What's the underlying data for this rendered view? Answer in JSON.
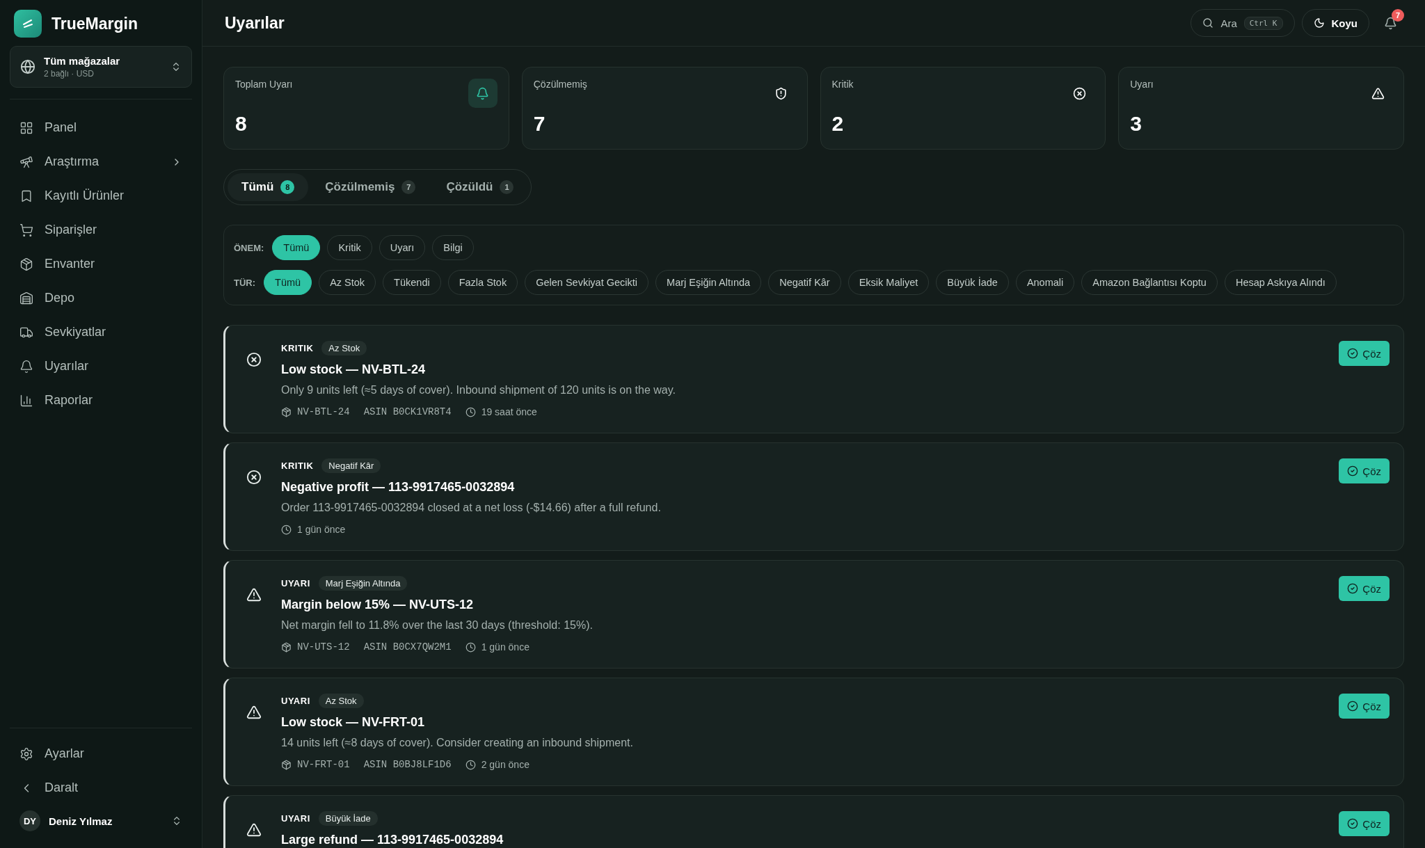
{
  "brand": {
    "name": "TrueMargin"
  },
  "store_picker": {
    "title": "Tüm mağazalar",
    "subtitle": "2 bağlı · USD"
  },
  "nav": [
    {
      "label": "Panel",
      "has_submenu": false
    },
    {
      "label": "Araştırma",
      "has_submenu": true
    },
    {
      "label": "Kayıtlı Ürünler",
      "has_submenu": false
    },
    {
      "label": "Siparişler",
      "has_submenu": false
    },
    {
      "label": "Envanter",
      "has_submenu": false
    },
    {
      "label": "Depo",
      "has_submenu": false
    },
    {
      "label": "Sevkiyatlar",
      "has_submenu": false
    },
    {
      "label": "Uyarılar",
      "has_submenu": false
    },
    {
      "label": "Raporlar",
      "has_submenu": false
    }
  ],
  "sidebar_footer": [
    {
      "label": "Ayarlar"
    },
    {
      "label": "Daralt"
    }
  ],
  "user": {
    "initials": "DY",
    "name": "Deniz Yılmaz"
  },
  "header": {
    "title": "Uyarılar",
    "search": {
      "label": "Ara",
      "shortcut": "Ctrl K"
    },
    "theme": "Koyu",
    "notifications": "7"
  },
  "stats": [
    {
      "label": "Toplam Uyarı",
      "value": "8",
      "highlighted": true
    },
    {
      "label": "Çözülmemiş",
      "value": "7",
      "highlighted": false
    },
    {
      "label": "Kritik",
      "value": "2",
      "highlighted": false
    },
    {
      "label": "Uyarı",
      "value": "3",
      "highlighted": false
    }
  ],
  "tabs": [
    {
      "label": "Tümü",
      "count": "8",
      "selected": true
    },
    {
      "label": "Çözülmemiş",
      "count": "7",
      "selected": false
    },
    {
      "label": "Çözüldü",
      "count": "1",
      "selected": false
    }
  ],
  "filters": [
    {
      "label": "ÖNEM:",
      "options": [
        {
          "label": "Tümü",
          "selected": true
        },
        {
          "label": "Kritik",
          "selected": false
        },
        {
          "label": "Uyarı",
          "selected": false
        },
        {
          "label": "Bilgi",
          "selected": false
        }
      ]
    },
    {
      "label": "TÜR:",
      "options": [
        {
          "label": "Tümü",
          "selected": true
        },
        {
          "label": "Az Stok",
          "selected": false
        },
        {
          "label": "Tükendi",
          "selected": false
        },
        {
          "label": "Fazla Stok",
          "selected": false
        },
        {
          "label": "Gelen Sevkiyat Gecikti",
          "selected": false
        },
        {
          "label": "Marj Eşiğin Altında",
          "selected": false
        },
        {
          "label": "Negatif Kâr",
          "selected": false
        },
        {
          "label": "Eksik Maliyet",
          "selected": false
        },
        {
          "label": "Büyük İade",
          "selected": false
        },
        {
          "label": "Anomali",
          "selected": false
        },
        {
          "label": "Amazon Bağlantısı Koptu",
          "selected": false
        },
        {
          "label": "Hesap Askıya Alındı",
          "selected": false
        }
      ]
    }
  ],
  "alerts": [
    {
      "kind": "critical",
      "severity": "KRITIK",
      "type": "Az Stok",
      "title": "Low stock — NV-BTL-24",
      "message": "Only 9 units left (≈5 days of cover). Inbound shipment of 120 units is on the way.",
      "sku": "NV-BTL-24",
      "asin": "ASIN B0CK1VR8T4",
      "time": "19 saat önce",
      "action": "Çöz"
    },
    {
      "kind": "critical",
      "severity": "KRITIK",
      "type": "Negatif Kâr",
      "title": "Negative profit — 113-9917465-0032894",
      "message": "Order 113-9917465-0032894 closed at a net loss (-$14.66) after a full refund.",
      "time": "1 gün önce",
      "action": "Çöz"
    },
    {
      "kind": "warning",
      "severity": "UYARI",
      "type": "Marj Eşiğin Altında",
      "title": "Margin below 15% — NV-UTS-12",
      "message": "Net margin fell to 11.8% over the last 30 days (threshold: 15%).",
      "sku": "NV-UTS-12",
      "asin": "ASIN B0CX7QW2M1",
      "time": "1 gün önce",
      "action": "Çöz"
    },
    {
      "kind": "warning",
      "severity": "UYARI",
      "type": "Az Stok",
      "title": "Low stock — NV-FRT-01",
      "message": "14 units left (≈8 days of cover). Consider creating an inbound shipment.",
      "sku": "NV-FRT-01",
      "asin": "ASIN B0BJ8LF1D6",
      "time": "2 gün önce",
      "action": "Çöz"
    },
    {
      "kind": "warning",
      "severity": "UYARI",
      "type": "Büyük İade",
      "title": "Large refund — 113-9917465-0032894",
      "action": "Çöz"
    }
  ]
}
